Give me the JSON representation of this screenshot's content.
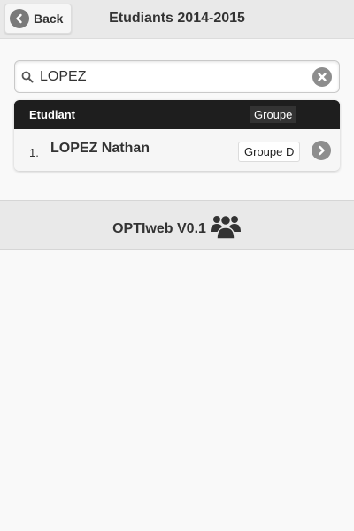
{
  "header": {
    "back_label": "Back",
    "title": "Etudiants 2014-2015"
  },
  "search": {
    "value": "LOPEZ"
  },
  "list": {
    "columns": {
      "student": "Etudiant",
      "group": "Groupe"
    },
    "rows": [
      {
        "index": "1.",
        "name": "LOPEZ Nathan",
        "group": "Groupe D"
      }
    ]
  },
  "footer": {
    "text": "OPTIweb V0.1",
    "icon": "users-icon"
  },
  "colors": {
    "header_bg": "#e9e9e9",
    "list_header_bg": "#1e1e1e",
    "icon_grey": "#8d8d8d",
    "page_bg": "#f9f9f9"
  }
}
